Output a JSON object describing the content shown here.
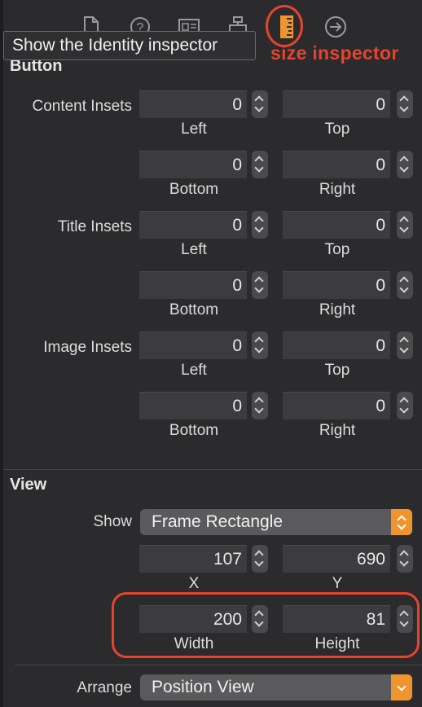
{
  "tooltip": "Show the Identity inspector",
  "annotation": {
    "size_inspector_label": "size inspector",
    "color": "#e8432d"
  },
  "toolbar": {
    "icons": [
      "file-icon",
      "help-icon",
      "identity-icon",
      "attributes-icon",
      "size-ruler-icon",
      "connections-icon"
    ]
  },
  "button_section": {
    "title": "Button",
    "groups": [
      {
        "label": "Content Insets",
        "left": "0",
        "top": "0",
        "bottom": "0",
        "right": "0",
        "left_label": "Left",
        "top_label": "Top",
        "bottom_label": "Bottom",
        "right_label": "Right"
      },
      {
        "label": "Title Insets",
        "left": "0",
        "top": "0",
        "bottom": "0",
        "right": "0",
        "left_label": "Left",
        "top_label": "Top",
        "bottom_label": "Bottom",
        "right_label": "Right"
      },
      {
        "label": "Image Insets",
        "left": "0",
        "top": "0",
        "bottom": "0",
        "right": "0",
        "left_label": "Left",
        "top_label": "Top",
        "bottom_label": "Bottom",
        "right_label": "Right"
      }
    ]
  },
  "view_section": {
    "title": "View",
    "show_label": "Show",
    "show_value": "Frame Rectangle",
    "x_value": "107",
    "y_value": "690",
    "x_label": "X",
    "y_label": "Y",
    "width_value": "200",
    "height_value": "81",
    "width_label": "Width",
    "height_label": "Height",
    "arrange_label": "Arrange",
    "arrange_value": "Position View"
  },
  "colors": {
    "background": "#2b2b2d",
    "accent": "#f0952e",
    "annotation": "#e8432d"
  }
}
